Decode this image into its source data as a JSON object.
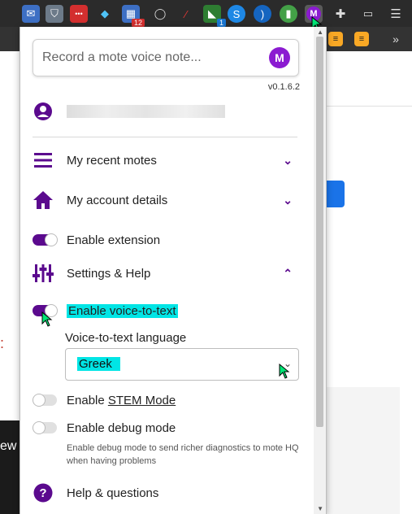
{
  "extensions_bar": {
    "active_badge_1": "12",
    "active_badge_2": "1"
  },
  "popup": {
    "input_placeholder": "Record a mote voice note...",
    "version": "v0.1.6.2",
    "menu": {
      "recent": "My recent motes",
      "account": "My account details",
      "enable_extension": "Enable extension",
      "settings": "Settings & Help"
    },
    "settings": {
      "voice_to_text": "Enable voice-to-text",
      "language_label": "Voice-to-text language",
      "language_value": "Greek",
      "stem_prefix": "Enable ",
      "stem_link": "STEM Mode",
      "debug": "Enable debug mode",
      "debug_desc": "Enable debug mode to send richer diagnostics to mote HQ when having problems"
    },
    "help": "Help & questions"
  },
  "background": {
    "left_text": "ew"
  },
  "colors": {
    "accent": "#5b0a8e",
    "brand": "#8b1bd1",
    "highlight": "#00e5e5"
  }
}
